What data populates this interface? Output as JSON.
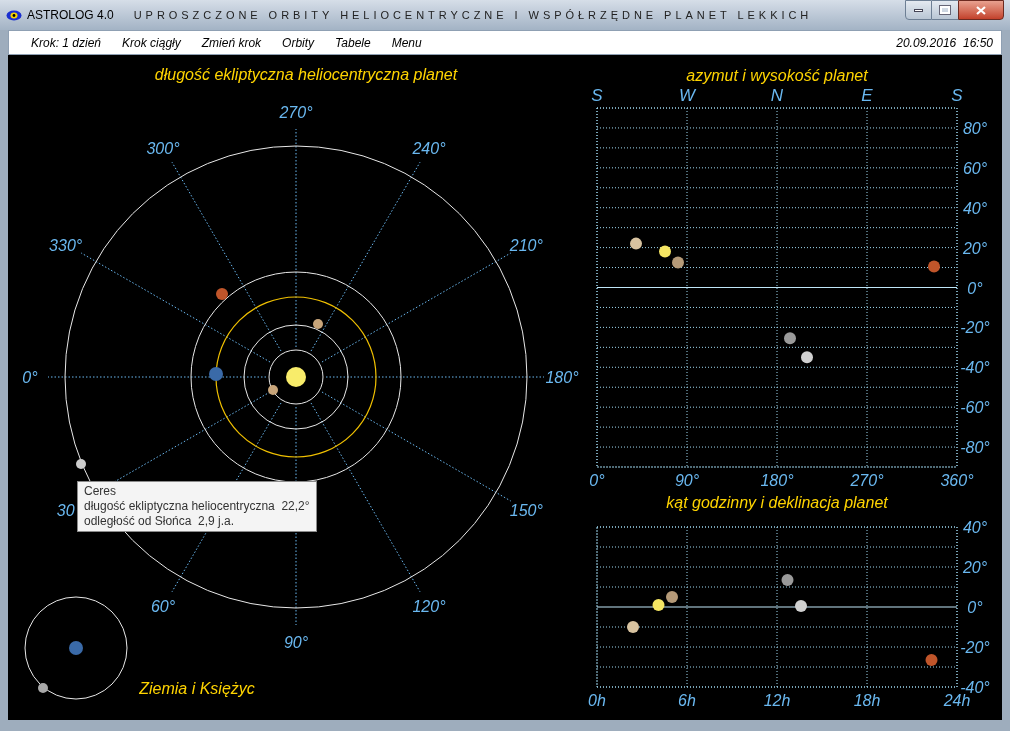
{
  "window": {
    "app": "ASTROLOG 4.0",
    "title": "UPROSZCZONE ORBITY HELIOCENTRYCZNE I WSPÓŁRZĘDNE PLANET LEKKICH"
  },
  "menu": [
    "Krok: 1 dzień",
    "Krok ciągły",
    "Zmień krok",
    "Orbity",
    "Tabele",
    "Menu"
  ],
  "datetime": "20.09.2016  16:50",
  "heliocentric": {
    "title": "długość ekliptyczna heliocentryczna planet",
    "angle_labels": [
      "0°",
      "30",
      "60°",
      "90°",
      "120°",
      "150°",
      "180°",
      "210°",
      "240°",
      "270°",
      "300°",
      "330°"
    ]
  },
  "tooltip": {
    "lines": [
      "Ceres",
      "długość ekliptyczna heliocentryczna  22,2°",
      "odległość od Słońca  2,9 j.a."
    ]
  },
  "earth_moon": {
    "title": "Ziemia i Księżyc"
  },
  "horizon": {
    "compass": [
      "S",
      "W",
      "N",
      "E",
      "S"
    ],
    "chart_data": {
      "type": "scatter",
      "title": "azymut i wysokość planet",
      "xlim": [
        0,
        360
      ],
      "ylim": [
        -90,
        90
      ],
      "grid": true,
      "ref_lines": [
        {
          "axis": "y",
          "value": 0
        }
      ],
      "xticks": [
        {
          "value": 0,
          "label": "0°"
        },
        {
          "value": 90,
          "label": "90°"
        },
        {
          "value": 180,
          "label": "180°"
        },
        {
          "value": 270,
          "label": "270°"
        },
        {
          "value": 360,
          "label": "360°"
        }
      ],
      "yticks": [
        {
          "value": 80,
          "label": "80°"
        },
        {
          "value": 60,
          "label": "60°"
        },
        {
          "value": 40,
          "label": "40°"
        },
        {
          "value": 20,
          "label": "20°"
        },
        {
          "value": 0,
          "label": "0°"
        },
        {
          "value": -20,
          "label": "-20°"
        },
        {
          "value": -40,
          "label": "-40°"
        },
        {
          "value": -60,
          "label": "-60°"
        },
        {
          "value": -80,
          "label": "-80°"
        }
      ],
      "series": [
        {
          "color": "#d8c3a0",
          "x": [
            39
          ],
          "values": [
            22
          ]
        },
        {
          "color": "#f5e663",
          "x": [
            68
          ],
          "values": [
            18
          ]
        },
        {
          "color": "#b59a78",
          "x": [
            81
          ],
          "values": [
            12.5
          ]
        },
        {
          "color": "#c0552a",
          "x": [
            337
          ],
          "values": [
            10.5
          ]
        },
        {
          "color": "#9a9a9a",
          "x": [
            193
          ],
          "values": [
            -25.5
          ]
        },
        {
          "color": "#d0d0d0",
          "x": [
            210
          ],
          "values": [
            -35
          ]
        }
      ]
    }
  },
  "hour_angle": {
    "chart_data": {
      "type": "scatter",
      "title": "kąt godzinny i deklinacja planet",
      "xlim": [
        0,
        24
      ],
      "ylim": [
        -40,
        40
      ],
      "grid": true,
      "ref_lines": [
        {
          "axis": "y",
          "value": 0
        }
      ],
      "xticks": [
        {
          "value": 0,
          "label": "0h"
        },
        {
          "value": 6,
          "label": "6h"
        },
        {
          "value": 12,
          "label": "12h"
        },
        {
          "value": 18,
          "label": "18h"
        },
        {
          "value": 24,
          "label": "24h"
        }
      ],
      "yticks": [
        {
          "value": 40,
          "label": "40°"
        },
        {
          "value": 20,
          "label": "20°"
        },
        {
          "value": 0,
          "label": "0°"
        },
        {
          "value": -20,
          "label": "-20°"
        },
        {
          "value": -40,
          "label": "-40°"
        }
      ],
      "series": [
        {
          "color": "#d8c3a0",
          "x": [
            2.4
          ],
          "values": [
            -10
          ]
        },
        {
          "color": "#f5e663",
          "x": [
            4.1
          ],
          "values": [
            1
          ]
        },
        {
          "color": "#b59a78",
          "x": [
            5
          ],
          "values": [
            5
          ]
        },
        {
          "color": "#c0552a",
          "x": [
            22.3
          ],
          "values": [
            -26.5
          ]
        },
        {
          "color": "#9a9a9a",
          "x": [
            12.7
          ],
          "values": [
            13.5
          ]
        },
        {
          "color": "#d0d0d0",
          "x": [
            13.6
          ],
          "values": [
            0.5
          ]
        }
      ]
    }
  }
}
